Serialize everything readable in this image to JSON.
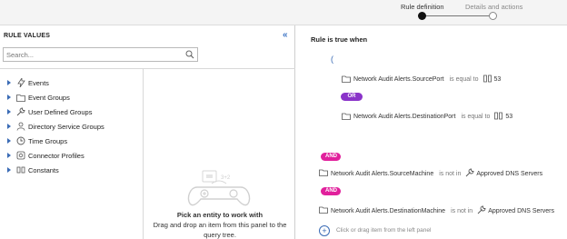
{
  "stepper": {
    "step1": "Rule definition",
    "step2": "Details and actions"
  },
  "left": {
    "title": "RULE VALUES",
    "collapse_glyph": "«",
    "search_placeholder": "Search...",
    "tree": [
      {
        "label": "Events",
        "icon": "lightning-icon"
      },
      {
        "label": "Event Groups",
        "icon": "folder-icon"
      },
      {
        "label": "User Defined Groups",
        "icon": "wrench-icon"
      },
      {
        "label": "Directory Service Groups",
        "icon": "user-icon"
      },
      {
        "label": "Time Groups",
        "icon": "clock-icon"
      },
      {
        "label": "Connector Profiles",
        "icon": "plug-icon"
      },
      {
        "label": "Constants",
        "icon": "constants-icon"
      }
    ],
    "empty_title": "Pick an entity to work with",
    "empty_desc": "Drag and drop an item from this panel to the query tree."
  },
  "right": {
    "header": "Rule is true when",
    "open_paren": "(",
    "or_label": "OR",
    "and_label": "AND",
    "conditions": [
      {
        "field": "Network Audit Alerts.SourcePort",
        "operator": "is equal to",
        "value": "53"
      },
      {
        "field": "Network Audit Alerts.DestinationPort",
        "operator": "is equal to",
        "value": "53"
      },
      {
        "field": "Network Audit Alerts.SourceMachine",
        "operator": "is not in",
        "value": "Approved DNS Servers"
      },
      {
        "field": "Network Audit Alerts.DestinationMachine",
        "operator": "is not in",
        "value": "Approved DNS Servers"
      }
    ],
    "add_hint": "Click or drag item from the left panel"
  },
  "colors": {
    "or_badge": "#8a33c9",
    "and_badge": "#e1209c",
    "accent": "#3a6bb5"
  }
}
